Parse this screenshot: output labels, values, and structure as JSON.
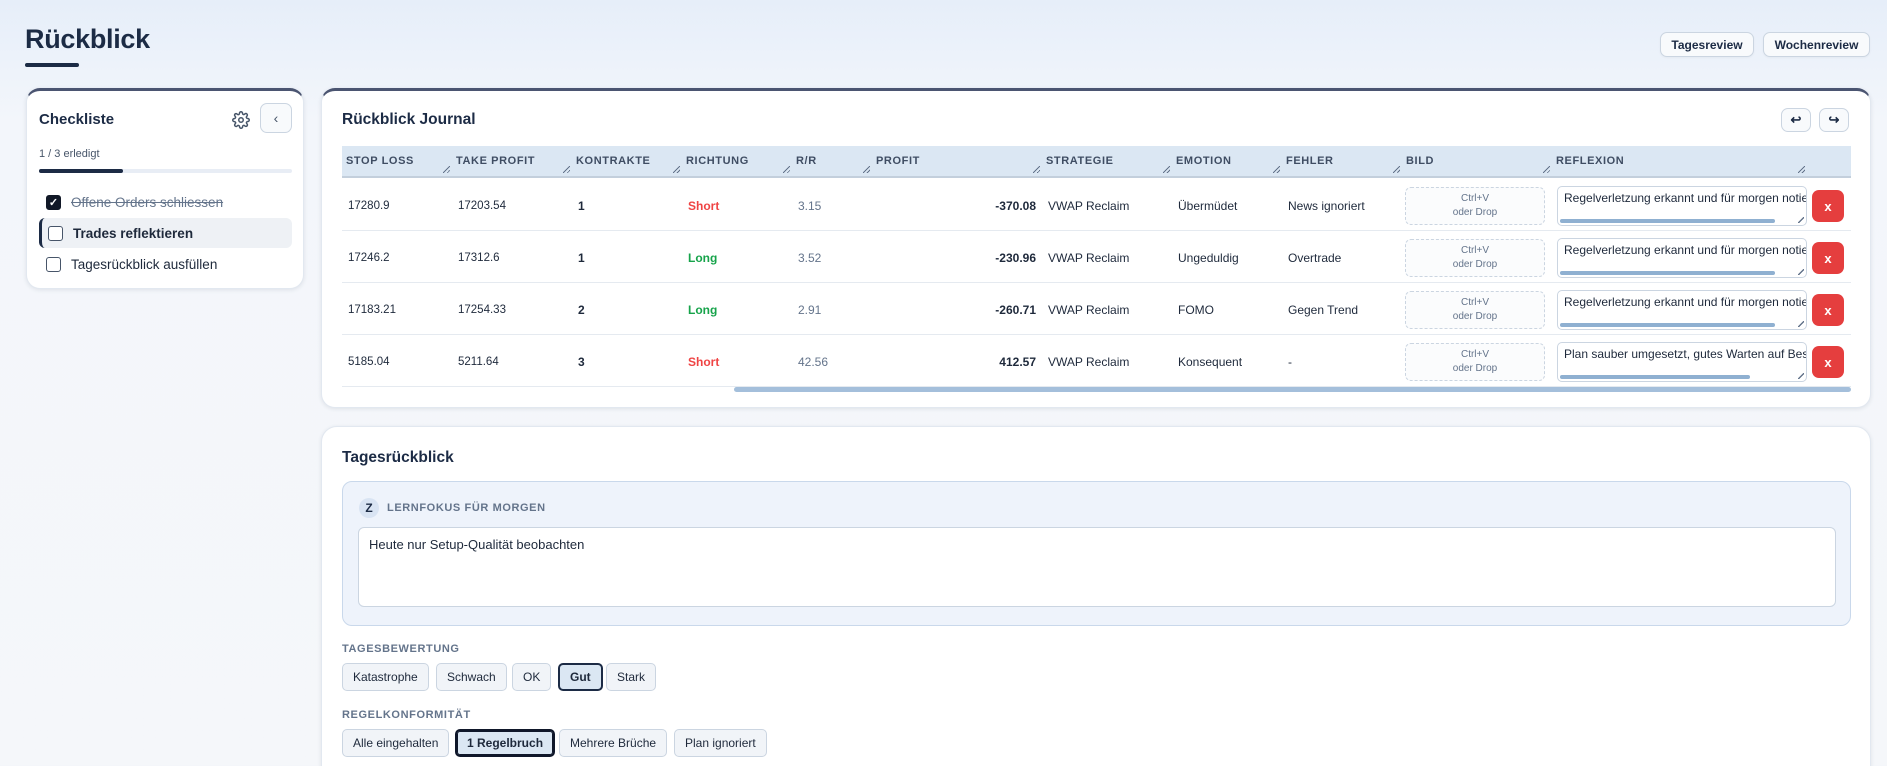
{
  "page": {
    "title": "Rückblick"
  },
  "top_actions": {
    "day_review": "Tagesreview",
    "week_review": "Wochenreview"
  },
  "checklist": {
    "title": "Checkliste",
    "progress_text": "1 / 3 erledigt",
    "progress_fraction": 0.333,
    "collapse_icon": "chevron-left-icon",
    "settings_icon": "gear-icon",
    "items": [
      {
        "label": "Offene Orders schliessen",
        "checked": true
      },
      {
        "label": "Trades reflektieren",
        "checked": false,
        "active": true
      },
      {
        "label": "Tagesrückblick ausfüllen",
        "checked": false
      }
    ]
  },
  "journal": {
    "title": "Rückblick Journal",
    "undo_icon": "undo-icon",
    "redo_icon": "redo-icon",
    "columns": [
      "STOP LOSS",
      "TAKE PROFIT",
      "KONTRAKTE",
      "RICHTUNG",
      "R/R",
      "PROFIT",
      "STRATEGIE",
      "EMOTION",
      "FEHLER",
      "BILD",
      "REFLEXION"
    ],
    "image_drop_line1": "Ctrl+V",
    "image_drop_line2": "oder Drop",
    "delete_label": "x",
    "rows": [
      {
        "stop_loss": "17280.9",
        "take_profit": "17203.54",
        "contracts": "1",
        "direction": "Short",
        "rr": "3.15",
        "profit": "-370.08",
        "strategy": "VWAP Reclaim",
        "emotion": "Übermüdet",
        "error": "News ignoriert",
        "reflection": "Regelverletzung erkannt und für morgen notiert"
      },
      {
        "stop_loss": "17246.2",
        "take_profit": "17312.6",
        "contracts": "1",
        "direction": "Long",
        "rr": "3.52",
        "profit": "-230.96",
        "strategy": "VWAP Reclaim",
        "emotion": "Ungeduldig",
        "error": "Overtrade",
        "reflection": "Regelverletzung erkannt und für morgen notiert"
      },
      {
        "stop_loss": "17183.21",
        "take_profit": "17254.33",
        "contracts": "2",
        "direction": "Long",
        "rr": "2.91",
        "profit": "-260.71",
        "strategy": "VWAP Reclaim",
        "emotion": "FOMO",
        "error": "Gegen Trend",
        "reflection": "Regelverletzung erkannt und für morgen notiert"
      },
      {
        "stop_loss": "5185.04",
        "take_profit": "5211.64",
        "contracts": "3",
        "direction": "Short",
        "rr": "42.56",
        "profit": "412.57",
        "strategy": "VWAP Reclaim",
        "emotion": "Konsequent",
        "error": "-",
        "reflection": "Plan sauber umgesetzt, gutes Warten auf Bestätigung"
      }
    ]
  },
  "day_review": {
    "title": "Tagesrückblick",
    "focus_badge": "Z",
    "focus_label": "LERNFOKUS FÜR MORGEN",
    "focus_value": "Heute nur Setup-Qualität beobachten",
    "rating_label": "TAGESBEWERTUNG",
    "rating_options": [
      "Katastrophe",
      "Schwach",
      "OK",
      "Gut",
      "Stark"
    ],
    "rating_selected": "Gut",
    "rules_label": "REGELKONFORMITÄT",
    "rules_options": [
      "Alle eingehalten",
      "1 Regelbruch",
      "Mehrere Brüche",
      "Plan ignoriert"
    ],
    "rules_selected": "1 Regelbruch"
  },
  "colors": {
    "short": "#ef4444",
    "long": "#16a34a",
    "delete": "#e53e3e",
    "header_bg": "#dbe7f3",
    "accent": "#1c2b45"
  }
}
